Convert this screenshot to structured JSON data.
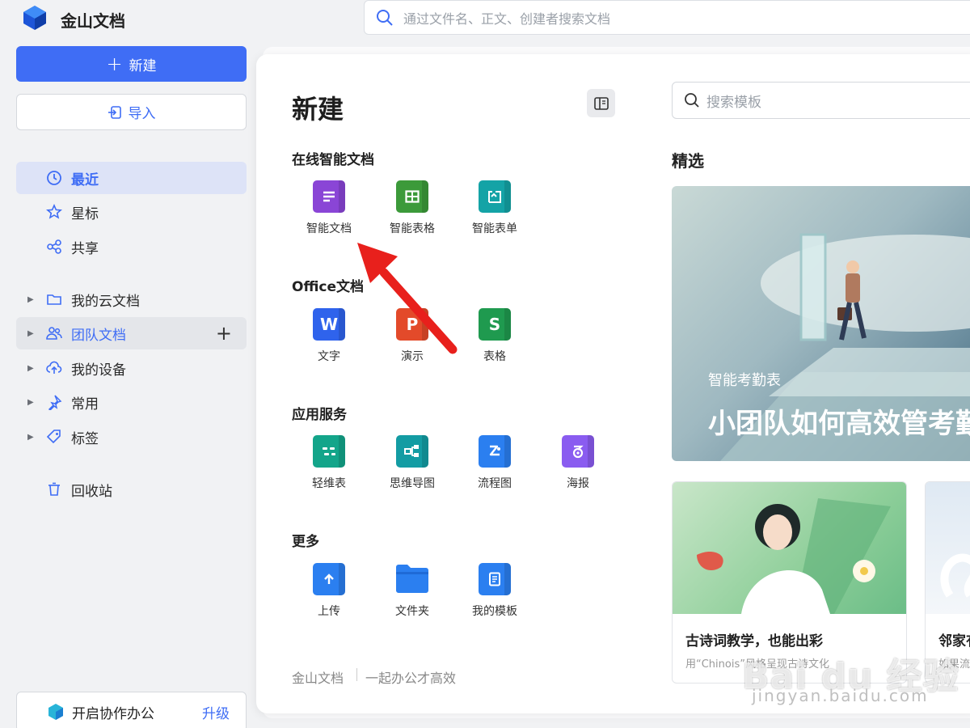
{
  "app": {
    "name": "金山文档"
  },
  "top_search": {
    "placeholder": "通过文件名、正文、创建者搜索文档"
  },
  "sidebar": {
    "new_label": "新建",
    "import_label": "导入",
    "items": [
      {
        "label": "最近",
        "icon": "clock-icon"
      },
      {
        "label": "星标",
        "icon": "star-icon"
      },
      {
        "label": "共享",
        "icon": "share-icon"
      },
      {
        "label": "我的云文档",
        "icon": "folder-icon"
      },
      {
        "label": "团队文档",
        "icon": "team-icon"
      },
      {
        "label": "我的设备",
        "icon": "cloud-upload-icon"
      },
      {
        "label": "常用",
        "icon": "pin-icon"
      },
      {
        "label": "标签",
        "icon": "tag-icon"
      },
      {
        "label": "回收站",
        "icon": "trash-icon"
      }
    ],
    "collab_label": "开启协作办公",
    "upgrade_label": "升级"
  },
  "panel": {
    "title": "新建",
    "sections": [
      {
        "title": "在线智能文档",
        "items": [
          {
            "label": "智能文档",
            "color": "#8a45d6"
          },
          {
            "label": "智能表格",
            "color": "#3c9a3a"
          },
          {
            "label": "智能表单",
            "color": "#14a3a6"
          }
        ]
      },
      {
        "title": "Office文档",
        "items": [
          {
            "label": "文字",
            "glyph": "W",
            "color": "#2f63ec"
          },
          {
            "label": "演示",
            "glyph": "P",
            "color": "#e34a2a"
          },
          {
            "label": "表格",
            "glyph": "S",
            "color": "#1f9a4f"
          }
        ]
      },
      {
        "title": "应用服务",
        "items": [
          {
            "label": "轻维表",
            "color": "#13a58a"
          },
          {
            "label": "思维导图",
            "color": "#139ca3"
          },
          {
            "label": "流程图",
            "color": "#2b7ff0"
          },
          {
            "label": "海报",
            "color": "#8a5cf0"
          }
        ]
      },
      {
        "title": "更多",
        "items": [
          {
            "label": "上传",
            "color": "#2b7ff0"
          },
          {
            "label": "文件夹",
            "color": "#2b7ff0"
          },
          {
            "label": "我的模板",
            "color": "#2b7ff0"
          }
        ]
      }
    ],
    "footer_brand": "金山文档",
    "footer_slogan": "一起办公才高效"
  },
  "templates": {
    "search_placeholder": "搜索模板",
    "featured_title": "精选",
    "hero": {
      "subtitle": "智能考勤表",
      "title": "小团队如何高效管考勤"
    },
    "cards": [
      {
        "title": "古诗词教学，也能出彩",
        "desc": "用“Chinois”风格呈现古诗文化"
      },
      {
        "title": "邻家有",
        "desc": "如果流"
      }
    ]
  },
  "watermark": {
    "text": "Bai du 经验",
    "url": "jingyan.baidu.com"
  },
  "colors": {
    "accent": "#3f6df5",
    "arrow": "#e8201c"
  }
}
